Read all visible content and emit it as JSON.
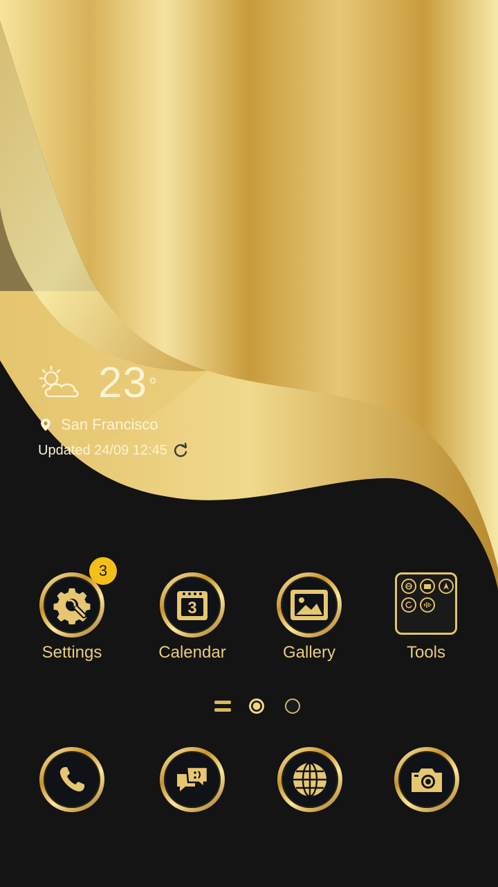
{
  "weather": {
    "temperature": "23",
    "degree_symbol": "°",
    "location": "San Francisco",
    "updated": "Updated 24/09 12:45",
    "icon": "partly-cloudy-icon"
  },
  "apps": [
    {
      "label": "Settings",
      "icon": "settings-gear-icon",
      "badge": "3"
    },
    {
      "label": "Calendar",
      "icon": "calendar-icon",
      "date": "3"
    },
    {
      "label": "Gallery",
      "icon": "gallery-icon"
    },
    {
      "label": "Tools",
      "icon": "tools-folder-icon"
    }
  ],
  "page_indicator": {
    "pages": 2,
    "current": 1
  },
  "dock": [
    {
      "icon": "phone-icon"
    },
    {
      "icon": "messages-icon"
    },
    {
      "icon": "browser-globe-icon"
    },
    {
      "icon": "camera-icon"
    }
  ],
  "colors": {
    "gold": "#e3c46c",
    "badge": "#f4bf18",
    "background": "#141414"
  }
}
